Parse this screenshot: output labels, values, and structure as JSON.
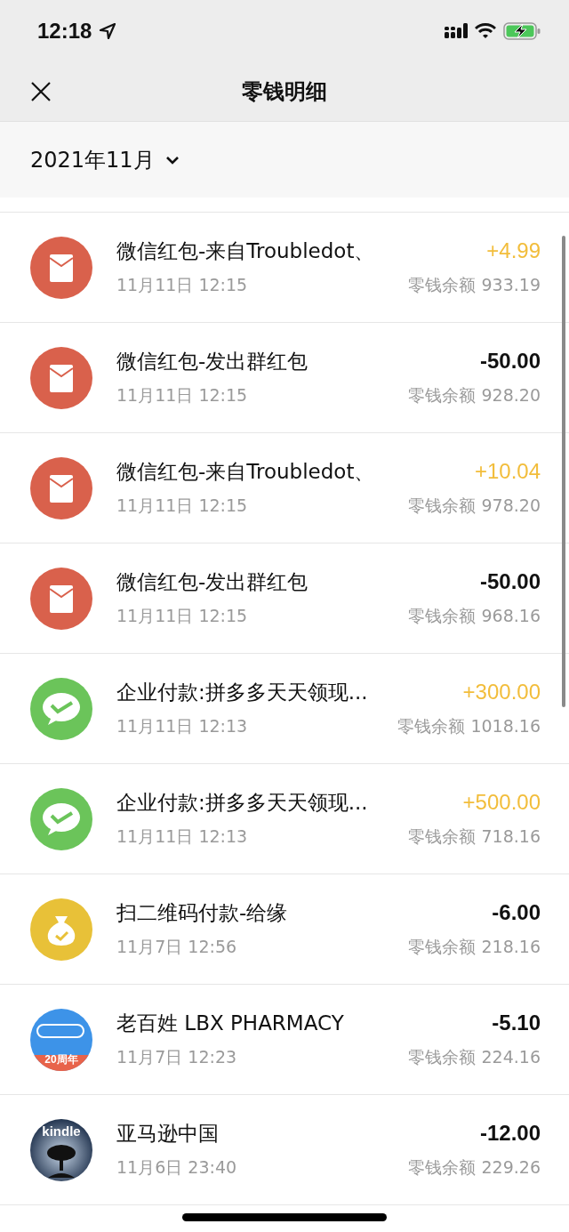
{
  "status_bar": {
    "time": "12:18"
  },
  "nav": {
    "title": "零钱明细"
  },
  "filter": {
    "month": "2021年11月"
  },
  "transactions": [
    {
      "kind": "red_packet",
      "title": "微信红包-来自Troubledot、",
      "date": "11月11日 12:15",
      "amount": "+4.99",
      "income": true,
      "balance": "零钱余额 933.19"
    },
    {
      "kind": "red_packet",
      "title": "微信红包-发出群红包",
      "date": "11月11日 12:15",
      "amount": "-50.00",
      "income": false,
      "balance": "零钱余额 928.20"
    },
    {
      "kind": "red_packet",
      "title": "微信红包-来自Troubledot、",
      "date": "11月11日 12:15",
      "amount": "+10.04",
      "income": true,
      "balance": "零钱余额 978.20"
    },
    {
      "kind": "red_packet",
      "title": "微信红包-发出群红包",
      "date": "11月11日 12:15",
      "amount": "-50.00",
      "income": false,
      "balance": "零钱余额 968.16"
    },
    {
      "kind": "wechat_pay",
      "title": "企业付款:拼多多天天领现...",
      "date": "11月11日 12:13",
      "amount": "+300.00",
      "income": true,
      "balance": "零钱余额 1018.16"
    },
    {
      "kind": "wechat_pay",
      "title": "企业付款:拼多多天天领现...",
      "date": "11月11日 12:13",
      "amount": "+500.00",
      "income": true,
      "balance": "零钱余额 718.16"
    },
    {
      "kind": "money_bag",
      "title": "扫二维码付款-给缘",
      "date": "11月7日 12:56",
      "amount": "-6.00",
      "income": false,
      "balance": "零钱余额 218.16"
    },
    {
      "kind": "pharmacy_logo",
      "logo_text": "20周年",
      "title": "老百姓 LBX PHARMACY",
      "date": "11月7日 12:23",
      "amount": "-5.10",
      "income": false,
      "balance": "零钱余额 224.16"
    },
    {
      "kind": "kindle_logo",
      "logo_text": "kindle",
      "title": "亚马逊中国",
      "date": "11月6日 23:40",
      "amount": "-12.00",
      "income": false,
      "balance": "零钱余额 229.26"
    }
  ]
}
